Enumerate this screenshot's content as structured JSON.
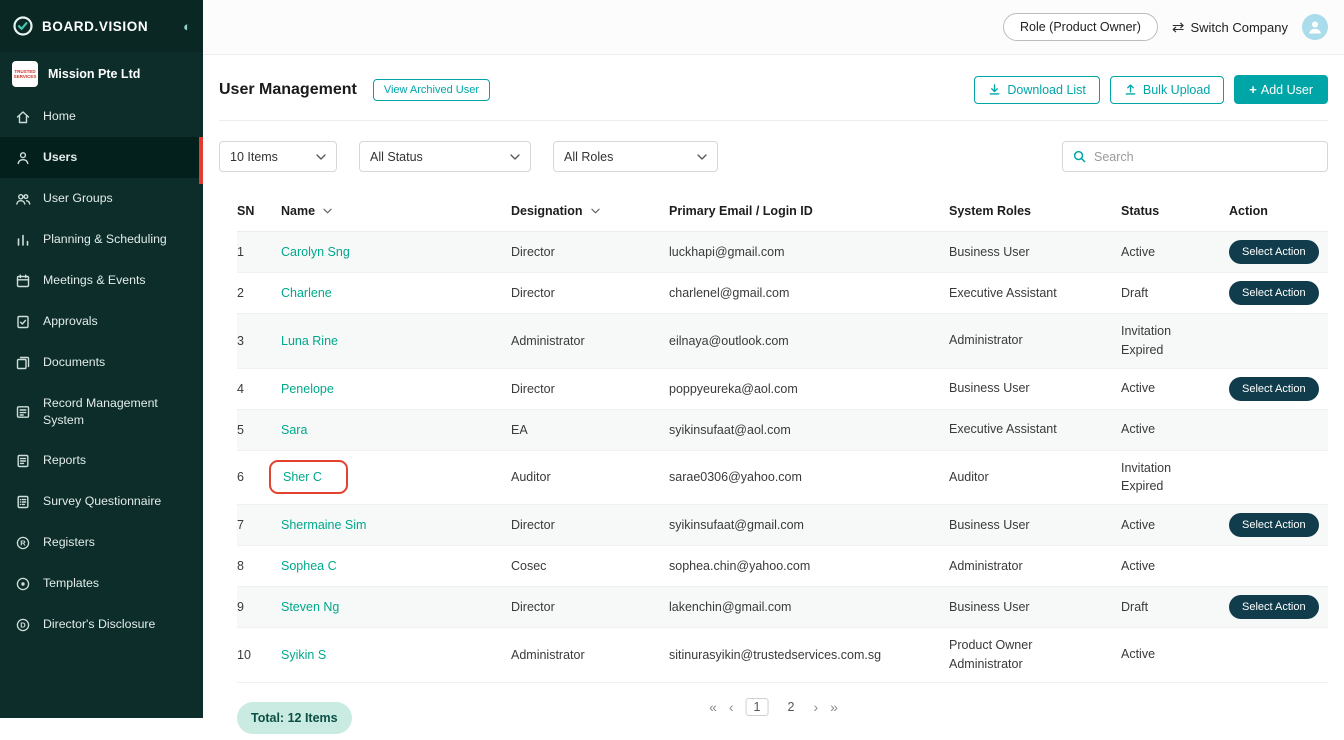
{
  "brand": {
    "name": "BOARD.VISION"
  },
  "icons": {
    "collapse": "◐",
    "switch": "⇄",
    "plus": "+"
  },
  "sidebar": {
    "company": "Mission Pte Ltd",
    "company_logo_text": "TRUSTED SERVICES",
    "items": [
      {
        "label": "Home",
        "icon": "home-icon"
      },
      {
        "label": "Users",
        "icon": "user-icon",
        "active": true
      },
      {
        "label": "User Groups",
        "icon": "user-groups-icon"
      },
      {
        "label": "Planning & Scheduling",
        "icon": "bar-chart-icon"
      },
      {
        "label": "Meetings & Events",
        "icon": "calendar-icon"
      },
      {
        "label": "Approvals",
        "icon": "document-check-icon"
      },
      {
        "label": "Documents",
        "icon": "documents-icon"
      },
      {
        "label": "Record Management System",
        "icon": "record-icon"
      },
      {
        "label": "Reports",
        "icon": "report-icon"
      },
      {
        "label": "Survey Questionnaire",
        "icon": "survey-icon"
      },
      {
        "label": "Registers",
        "icon": "register-icon"
      },
      {
        "label": "Templates",
        "icon": "template-icon"
      },
      {
        "label": "Director's Disclosure",
        "icon": "disclosure-icon"
      }
    ]
  },
  "topbar": {
    "role_label": "Role (Product Owner)",
    "switch_company": "Switch Company"
  },
  "header": {
    "title": "User Management",
    "view_archived": "View Archived User",
    "download_list": "Download List",
    "bulk_upload": "Bulk Upload",
    "add_user": "Add User"
  },
  "filters": {
    "items_per_page": "10 Items",
    "status": "All Status",
    "roles": "All Roles",
    "search_placeholder": "Search"
  },
  "table": {
    "columns": [
      {
        "label": "SN"
      },
      {
        "label": "Name",
        "sortable": true
      },
      {
        "label": "Designation",
        "sortable": true
      },
      {
        "label": "Primary Email / Login ID"
      },
      {
        "label": "System Roles"
      },
      {
        "label": "Status"
      },
      {
        "label": "Action"
      }
    ],
    "rows": [
      {
        "sn": "1",
        "name": "Carolyn Sng",
        "designation": "Director",
        "email": "luckhapi@gmail.com",
        "roles": "Business User",
        "status": "Active",
        "action": "Select Action"
      },
      {
        "sn": "2",
        "name": "Charlene",
        "designation": "Director",
        "email": "charlenel@gmail.com",
        "roles": "Executive Assistant",
        "status": "Draft",
        "action": "Select Action"
      },
      {
        "sn": "3",
        "name": "Luna Rine",
        "designation": "Administrator",
        "email": "eilnaya@outlook.com",
        "roles": "Administrator",
        "status": "Invitation\nExpired",
        "action": null
      },
      {
        "sn": "4",
        "name": "Penelope",
        "designation": "Director",
        "email": "poppyeureka@aol.com",
        "roles": "Business User",
        "status": "Active",
        "action": "Select Action"
      },
      {
        "sn": "5",
        "name": "Sara",
        "designation": "EA",
        "email": "syikinsufaat@aol.com",
        "roles": "Executive Assistant",
        "status": "Active",
        "action": null
      },
      {
        "sn": "6",
        "name": "Sher C",
        "designation": "Auditor",
        "email": "sarae0306@yahoo.com",
        "roles": "Auditor",
        "status": "Invitation\nExpired",
        "action": null,
        "highlighted": true
      },
      {
        "sn": "7",
        "name": "Shermaine Sim",
        "designation": "Director",
        "email": "syikinsufaat@gmail.com",
        "roles": "Business User",
        "status": "Active",
        "action": "Select Action"
      },
      {
        "sn": "8",
        "name": "Sophea C",
        "designation": "Cosec",
        "email": "sophea.chin@yahoo.com",
        "roles": "Administrator",
        "status": "Active",
        "action": null
      },
      {
        "sn": "9",
        "name": "Steven Ng",
        "designation": "Director",
        "email": "lakenchin@gmail.com",
        "roles": "Business User",
        "status": "Draft",
        "action": "Select Action"
      },
      {
        "sn": "10",
        "name": "Syikin S",
        "designation": "Administrator",
        "email": "sitinurasyikin@trustedservices.com.sg",
        "roles": "Product Owner\nAdministrator",
        "status": "Active",
        "action": null
      }
    ]
  },
  "footer": {
    "total": "Total: 12 Items",
    "pagination": {
      "first": "«",
      "prev": "‹",
      "pages": [
        "1",
        "2"
      ],
      "next": "›",
      "last": "»",
      "current_page": "1"
    }
  },
  "colors": {
    "accent": "#00A5A8",
    "link": "#00A88B",
    "action-button": "#113C4B",
    "annotation": "#E3432E",
    "sidebar-bg": "#0C2D2A",
    "sidebar-active": "#04201D",
    "active-indicator": "#E23B32",
    "badge-bg": "#C9EBE1",
    "badge-text": "#0B4F44"
  }
}
